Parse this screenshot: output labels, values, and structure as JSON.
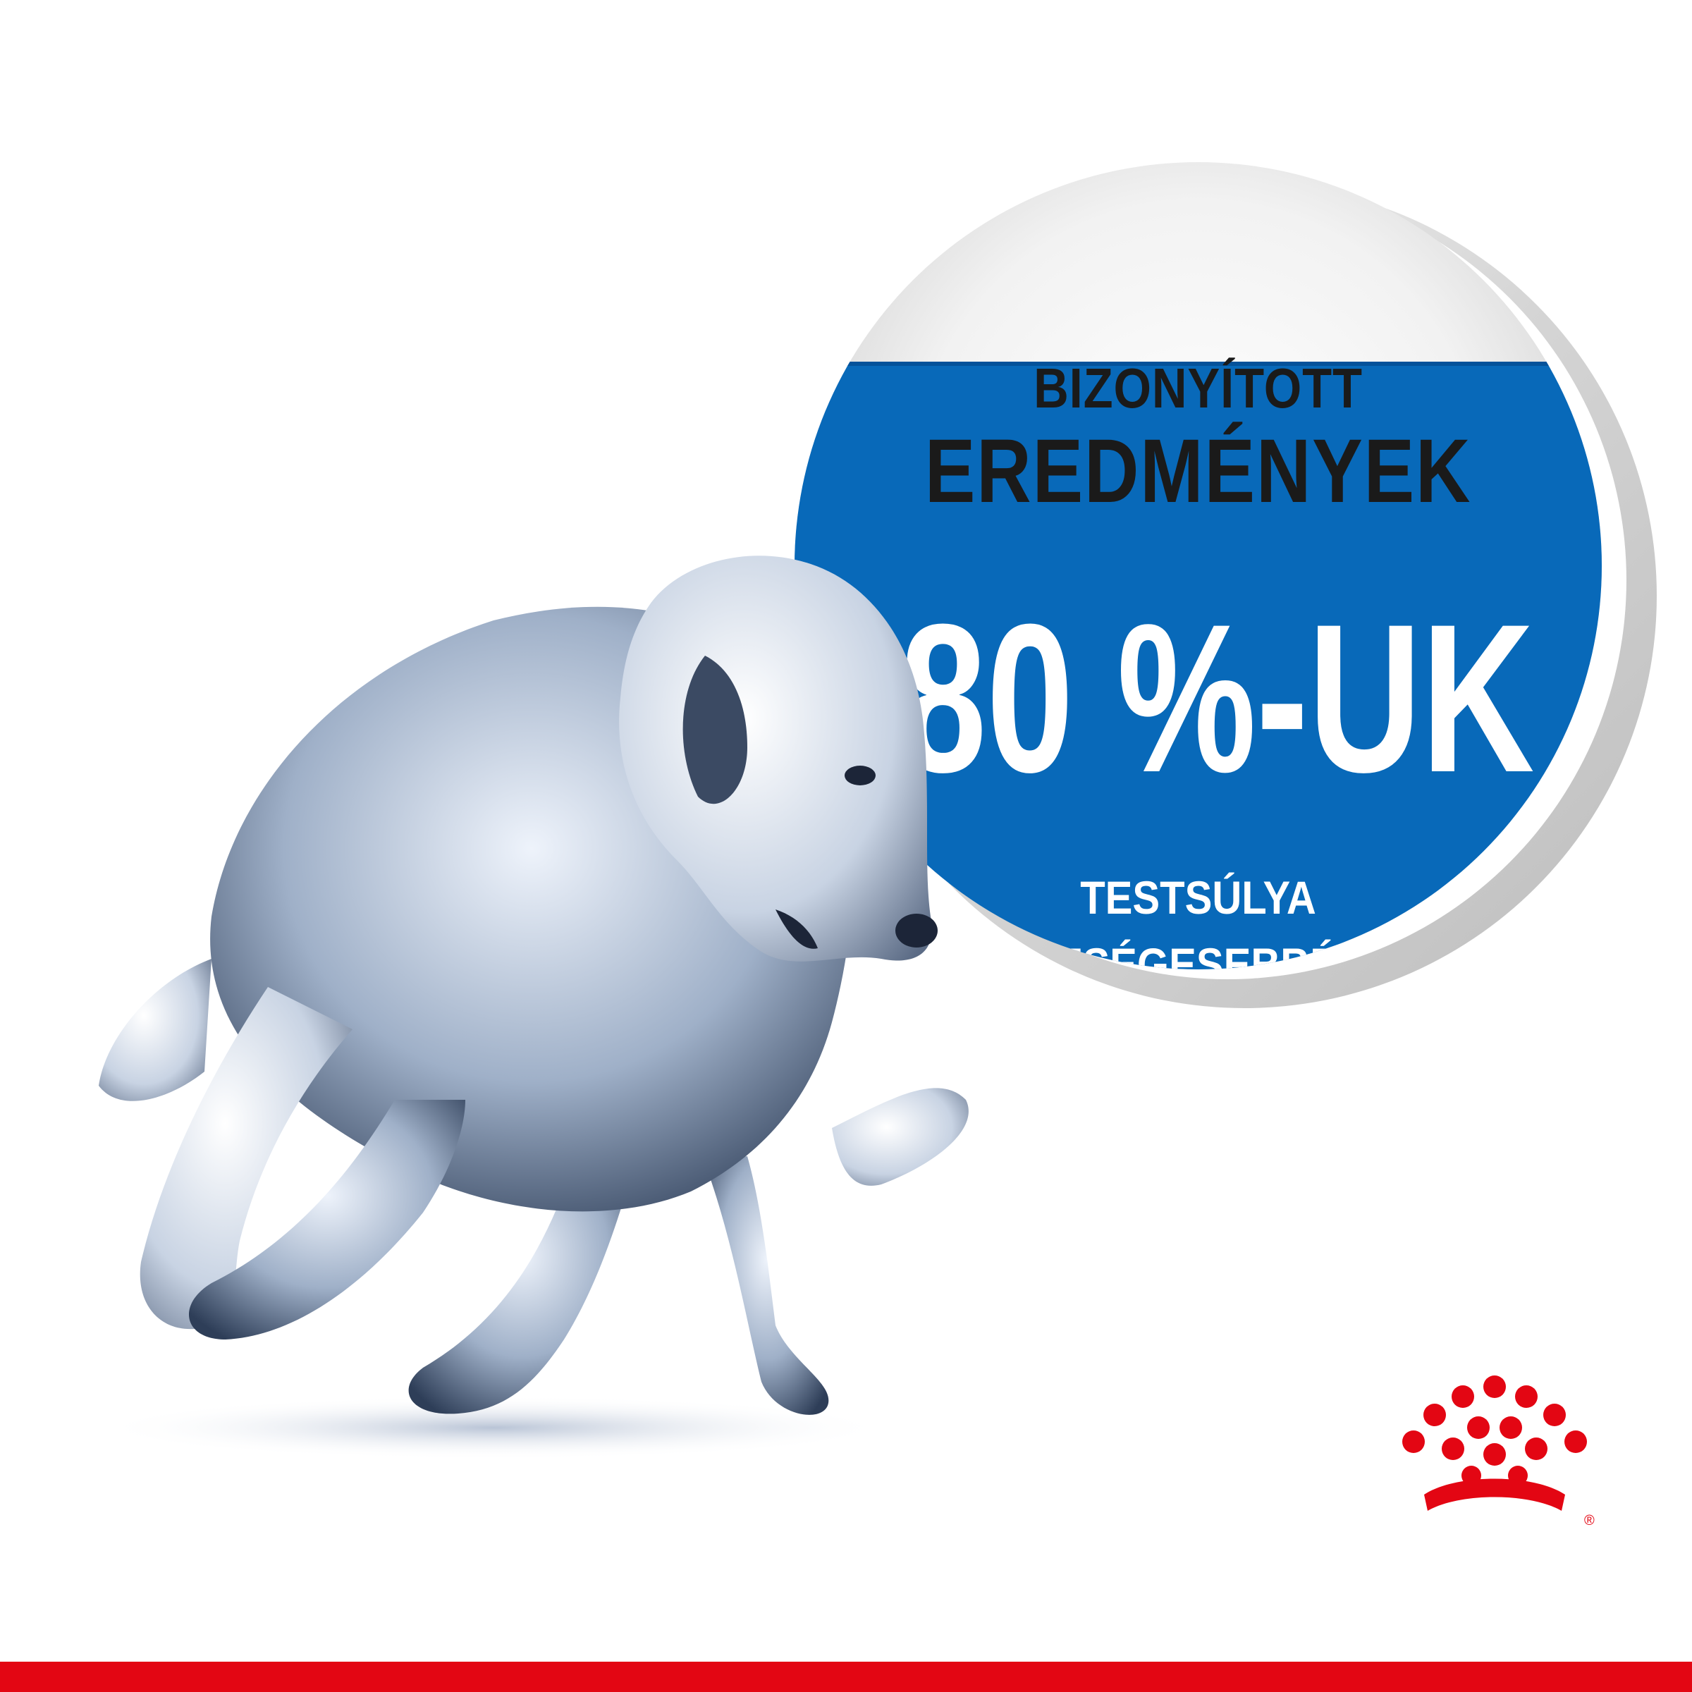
{
  "badge": {
    "line1": "BIZONYÍTOTT",
    "line2": "EREDMÉNYEK",
    "big": "80 %-UK",
    "sub1": "TESTSÚLYA",
    "sub2": "EGÉSZSÉGESEBBÉ VÁLT"
  },
  "logo": {
    "icon": "royal-canin-crown-icon",
    "registered": "®"
  },
  "colors": {
    "badge_blue": "#0869b9",
    "brand_red": "#e30613",
    "text_dark": "#1a1a1a"
  }
}
